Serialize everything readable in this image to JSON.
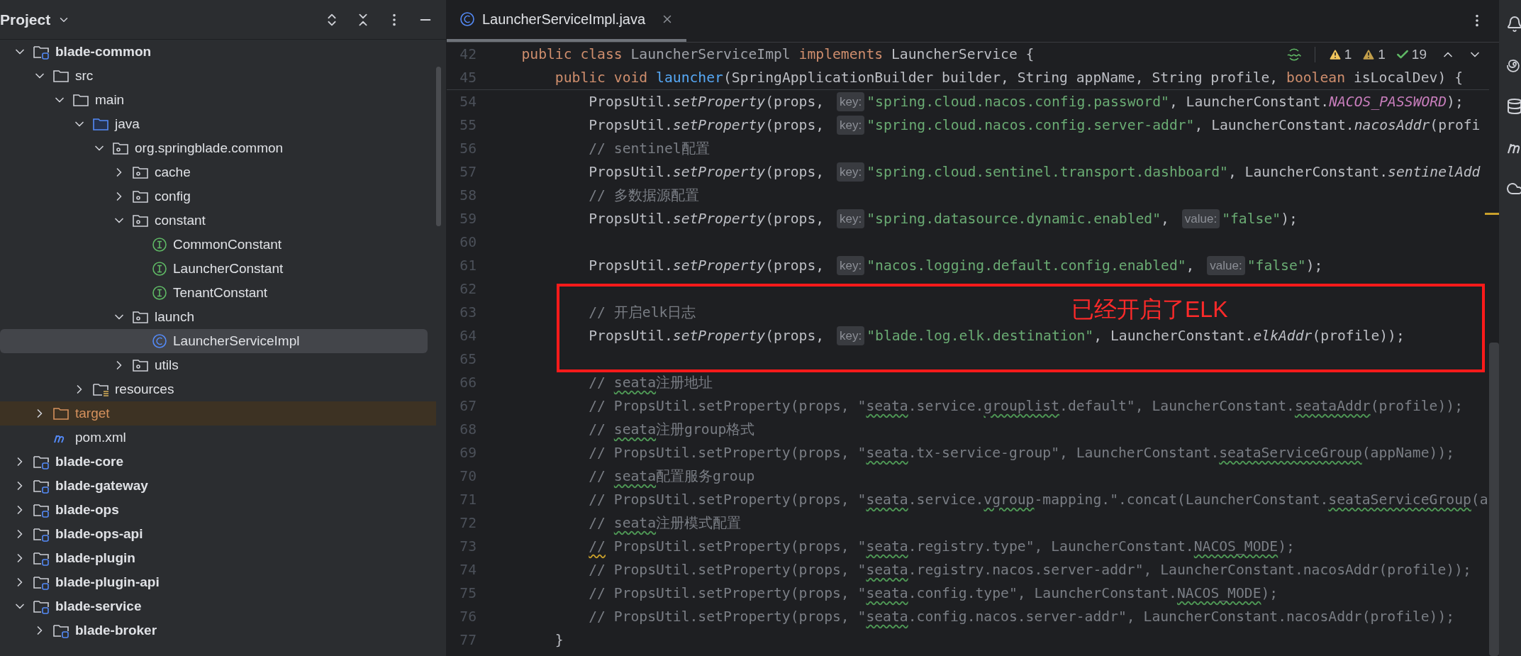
{
  "project_panel": {
    "title": "Project",
    "tree": [
      {
        "label": "blade-common",
        "kind": "module",
        "expanded": true,
        "selected": false,
        "children": [
          {
            "label": "src",
            "kind": "folder",
            "expanded": true,
            "selected": false,
            "children": [
              {
                "label": "main",
                "kind": "folder",
                "expanded": true,
                "selected": false,
                "children": [
                  {
                    "label": "java",
                    "kind": "source-root",
                    "expanded": true,
                    "selected": false,
                    "children": [
                      {
                        "label": "org.springblade.common",
                        "kind": "package",
                        "expanded": true,
                        "selected": false,
                        "children": [
                          {
                            "label": "cache",
                            "kind": "package",
                            "expanded": false,
                            "selected": false
                          },
                          {
                            "label": "config",
                            "kind": "package",
                            "expanded": false,
                            "selected": false
                          },
                          {
                            "label": "constant",
                            "kind": "package",
                            "expanded": true,
                            "selected": false,
                            "children": [
                              {
                                "label": "CommonConstant",
                                "kind": "interface",
                                "selected": false
                              },
                              {
                                "label": "LauncherConstant",
                                "kind": "interface",
                                "selected": false
                              },
                              {
                                "label": "TenantConstant",
                                "kind": "interface",
                                "selected": false
                              }
                            ]
                          },
                          {
                            "label": "launch",
                            "kind": "package",
                            "expanded": true,
                            "selected": false,
                            "children": [
                              {
                                "label": "LauncherServiceImpl",
                                "kind": "class",
                                "selected": true
                              }
                            ]
                          },
                          {
                            "label": "utils",
                            "kind": "package",
                            "expanded": false,
                            "selected": false
                          }
                        ]
                      }
                    ]
                  },
                  {
                    "label": "resources",
                    "kind": "resources",
                    "expanded": false,
                    "selected": false
                  }
                ]
              }
            ]
          },
          {
            "label": "target",
            "kind": "excluded",
            "expanded": false,
            "selected": false
          },
          {
            "label": "pom.xml",
            "kind": "maven",
            "selected": false
          }
        ]
      },
      {
        "label": "blade-core",
        "kind": "module",
        "expanded": false,
        "selected": false
      },
      {
        "label": "blade-gateway",
        "kind": "module",
        "expanded": false,
        "selected": false
      },
      {
        "label": "blade-ops",
        "kind": "module",
        "expanded": false,
        "selected": false
      },
      {
        "label": "blade-ops-api",
        "kind": "module",
        "expanded": false,
        "selected": false
      },
      {
        "label": "blade-plugin",
        "kind": "module",
        "expanded": false,
        "selected": false
      },
      {
        "label": "blade-plugin-api",
        "kind": "module",
        "expanded": false,
        "selected": false
      },
      {
        "label": "blade-service",
        "kind": "module",
        "expanded": true,
        "selected": false,
        "children": [
          {
            "label": "blade-broker",
            "kind": "module",
            "expanded": false,
            "selected": false
          }
        ]
      }
    ]
  },
  "editor": {
    "tab": {
      "label": "LauncherServiceImpl.java",
      "selected": true
    },
    "inspections": [
      {
        "kind": "warning",
        "count": "1"
      },
      {
        "kind": "weak-warning",
        "count": "1"
      },
      {
        "kind": "ok",
        "count": "19"
      }
    ],
    "sticky_lines": [
      {
        "number": "42",
        "tokens": [
          {
            "kind": "kw",
            "text": "    public class "
          },
          {
            "kind": "dim",
            "text": "LauncherServiceImpl "
          },
          {
            "kind": "kw",
            "text": "implements "
          },
          {
            "kind": "plain",
            "text": "LauncherService {"
          }
        ]
      },
      {
        "number": "45",
        "tokens": [
          {
            "kind": "kw",
            "text": "        public void "
          },
          {
            "kind": "fn",
            "text": "launcher"
          },
          {
            "kind": "plain",
            "text": "(SpringApplicationBuilder builder, String appName, String profile, "
          },
          {
            "kind": "kw",
            "text": "boolean "
          },
          {
            "kind": "plain",
            "text": "isLocalDev) {"
          }
        ]
      }
    ],
    "lines": [
      {
        "number": "54",
        "boxed": false,
        "tokens": [
          {
            "kind": "plain",
            "text": "            PropsUtil."
          },
          {
            "kind": "call",
            "text": "setProperty"
          },
          {
            "kind": "plain",
            "text": "(props, "
          },
          {
            "kind": "hint",
            "text": "key:"
          },
          {
            "kind": "str",
            "text": "\"spring.cloud.nacos.config.password\""
          },
          {
            "kind": "plain",
            "text": ", LauncherConstant."
          },
          {
            "kind": "const",
            "text": "NACOS_PASSWORD"
          },
          {
            "kind": "plain",
            "text": ");"
          }
        ]
      },
      {
        "number": "55",
        "boxed": false,
        "tokens": [
          {
            "kind": "plain",
            "text": "            PropsUtil."
          },
          {
            "kind": "call",
            "text": "setProperty"
          },
          {
            "kind": "plain",
            "text": "(props, "
          },
          {
            "kind": "hint",
            "text": "key:"
          },
          {
            "kind": "str",
            "text": "\"spring.cloud.nacos.config.server-addr\""
          },
          {
            "kind": "plain",
            "text": ", LauncherConstant."
          },
          {
            "kind": "call",
            "text": "nacosAddr"
          },
          {
            "kind": "plain",
            "text": "(profi"
          }
        ]
      },
      {
        "number": "56",
        "boxed": false,
        "tokens": [
          {
            "kind": "cmt",
            "text": "            // sentinel配置"
          }
        ]
      },
      {
        "number": "57",
        "boxed": false,
        "tokens": [
          {
            "kind": "plain",
            "text": "            PropsUtil."
          },
          {
            "kind": "call",
            "text": "setProperty"
          },
          {
            "kind": "plain",
            "text": "(props, "
          },
          {
            "kind": "hint",
            "text": "key:"
          },
          {
            "kind": "str",
            "text": "\"spring.cloud.sentinel.transport.dashboard\""
          },
          {
            "kind": "plain",
            "text": ", LauncherConstant."
          },
          {
            "kind": "call",
            "text": "sentinelAdd"
          }
        ]
      },
      {
        "number": "58",
        "boxed": false,
        "tokens": [
          {
            "kind": "cmt",
            "text": "            // 多数据源配置"
          }
        ]
      },
      {
        "number": "59",
        "boxed": false,
        "tokens": [
          {
            "kind": "plain",
            "text": "            PropsUtil."
          },
          {
            "kind": "call",
            "text": "setProperty"
          },
          {
            "kind": "plain",
            "text": "(props, "
          },
          {
            "kind": "hint",
            "text": "key:"
          },
          {
            "kind": "str",
            "text": "\"spring.datasource.dynamic.enabled\""
          },
          {
            "kind": "plain",
            "text": ", "
          },
          {
            "kind": "hint",
            "text": "value:"
          },
          {
            "kind": "str",
            "text": "\"false\""
          },
          {
            "kind": "plain",
            "text": ");"
          }
        ]
      },
      {
        "number": "60",
        "boxed": false
      },
      {
        "number": "61",
        "boxed": false,
        "tokens": [
          {
            "kind": "plain",
            "text": "            PropsUtil."
          },
          {
            "kind": "call",
            "text": "setProperty"
          },
          {
            "kind": "plain",
            "text": "(props, "
          },
          {
            "kind": "hint",
            "text": "key:"
          },
          {
            "kind": "str",
            "text": "\"nacos.logging.default.config.enabled\""
          },
          {
            "kind": "plain",
            "text": ", "
          },
          {
            "kind": "hint",
            "text": "value:"
          },
          {
            "kind": "str",
            "text": "\"false\""
          },
          {
            "kind": "plain",
            "text": ");"
          }
        ]
      },
      {
        "number": "62",
        "boxed": true
      },
      {
        "number": "63",
        "boxed": true,
        "tokens": [
          {
            "kind": "cmt",
            "text": "            // 开启elk日志"
          }
        ]
      },
      {
        "number": "64",
        "boxed": true,
        "tokens": [
          {
            "kind": "plain",
            "text": "            PropsUtil."
          },
          {
            "kind": "call",
            "text": "setProperty"
          },
          {
            "kind": "plain",
            "text": "(props, "
          },
          {
            "kind": "hint",
            "text": "key:"
          },
          {
            "kind": "str",
            "text": "\"blade.log.elk.destination\""
          },
          {
            "kind": "plain",
            "text": ", LauncherConstant."
          },
          {
            "kind": "call",
            "text": "elkAddr"
          },
          {
            "kind": "plain",
            "text": "(profile));"
          }
        ]
      },
      {
        "number": "65",
        "boxed": true
      },
      {
        "number": "66",
        "boxed": false,
        "tokens": [
          {
            "kind": "cmt",
            "text": "            // "
          },
          {
            "kind": "typo",
            "text": "seata"
          },
          {
            "kind": "cmt",
            "text": "注册地址"
          }
        ]
      },
      {
        "number": "67",
        "boxed": false,
        "tokens": [
          {
            "kind": "cmt",
            "text": "            // PropsUtil.setProperty(props, \""
          },
          {
            "kind": "typo",
            "text": "seata"
          },
          {
            "kind": "cmt",
            "text": ".service."
          },
          {
            "kind": "typo",
            "text": "grouplist"
          },
          {
            "kind": "cmt",
            "text": ".default\", LauncherConstant."
          },
          {
            "kind": "typo",
            "text": "seataAddr"
          },
          {
            "kind": "cmt",
            "text": "(profile));"
          }
        ]
      },
      {
        "number": "68",
        "boxed": false,
        "tokens": [
          {
            "kind": "cmt",
            "text": "            // "
          },
          {
            "kind": "typo",
            "text": "seata"
          },
          {
            "kind": "cmt",
            "text": "注册group格式"
          }
        ]
      },
      {
        "number": "69",
        "boxed": false,
        "tokens": [
          {
            "kind": "cmt",
            "text": "            // PropsUtil.setProperty(props, \""
          },
          {
            "kind": "typo",
            "text": "seata"
          },
          {
            "kind": "cmt",
            "text": ".tx-service-group\", LauncherConstant."
          },
          {
            "kind": "typo",
            "text": "seataServiceGroup"
          },
          {
            "kind": "cmt",
            "text": "(appName));"
          }
        ]
      },
      {
        "number": "70",
        "boxed": false,
        "tokens": [
          {
            "kind": "cmt",
            "text": "            // "
          },
          {
            "kind": "typo",
            "text": "seata"
          },
          {
            "kind": "cmt",
            "text": "配置服务group"
          }
        ]
      },
      {
        "number": "71",
        "boxed": false,
        "tokens": [
          {
            "kind": "cmt",
            "text": "            // PropsUtil.setProperty(props, \""
          },
          {
            "kind": "typo",
            "text": "seata"
          },
          {
            "kind": "cmt",
            "text": ".service."
          },
          {
            "kind": "typo",
            "text": "vgroup"
          },
          {
            "kind": "cmt",
            "text": "-mapping.\".concat(LauncherConstant."
          },
          {
            "kind": "typo",
            "text": "seataServiceGroup"
          },
          {
            "kind": "cmt",
            "text": "(a"
          }
        ]
      },
      {
        "number": "72",
        "boxed": false,
        "tokens": [
          {
            "kind": "cmt",
            "text": "            // "
          },
          {
            "kind": "typo",
            "text": "seata"
          },
          {
            "kind": "cmt",
            "text": "注册模式配置"
          }
        ]
      },
      {
        "number": "73",
        "boxed": false,
        "tokens": [
          {
            "kind": "warn",
            "text": "            //"
          },
          {
            "kind": "cmt",
            "text": " PropsUtil.setProperty(props, \""
          },
          {
            "kind": "typo",
            "text": "seata"
          },
          {
            "kind": "cmt",
            "text": ".registry.type\", LauncherConstant."
          },
          {
            "kind": "typo",
            "text": "NACOS_MODE"
          },
          {
            "kind": "cmt",
            "text": ");"
          }
        ]
      },
      {
        "number": "74",
        "boxed": false,
        "tokens": [
          {
            "kind": "cmt",
            "text": "            // PropsUtil.setProperty(props, \""
          },
          {
            "kind": "typo",
            "text": "seata"
          },
          {
            "kind": "cmt",
            "text": ".registry.nacos.server-addr\", LauncherConstant.nacosAddr(profile));"
          }
        ]
      },
      {
        "number": "75",
        "boxed": false,
        "tokens": [
          {
            "kind": "cmt",
            "text": "            // PropsUtil.setProperty(props, \""
          },
          {
            "kind": "typo",
            "text": "seata"
          },
          {
            "kind": "cmt",
            "text": ".config.type\", LauncherConstant."
          },
          {
            "kind": "typo",
            "text": "NACOS_MODE"
          },
          {
            "kind": "cmt",
            "text": ");"
          }
        ]
      },
      {
        "number": "76",
        "boxed": false,
        "tokens": [
          {
            "kind": "cmt",
            "text": "            // PropsUtil.setProperty(props, \""
          },
          {
            "kind": "typo",
            "text": "seata"
          },
          {
            "kind": "cmt",
            "text": ".config.nacos.server-addr\", LauncherConstant.nacosAddr(profile));"
          }
        ]
      },
      {
        "number": "77",
        "boxed": false,
        "tokens": [
          {
            "kind": "plain",
            "text": "        }"
          }
        ]
      }
    ],
    "annotation": {
      "text": "已经开启了ELK"
    }
  }
}
